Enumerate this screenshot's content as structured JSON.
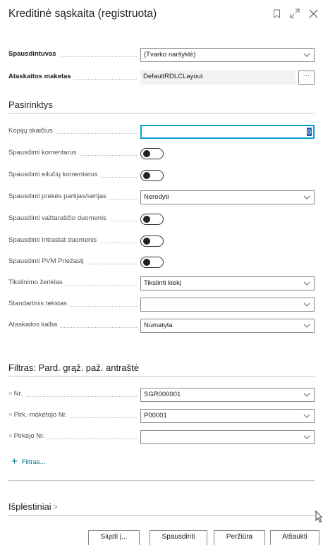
{
  "dialog": {
    "title": "Kreditinė sąskaita (registruota)",
    "icons": [
      "bookmark-icon",
      "expand-icon",
      "close-icon"
    ]
  },
  "printer": {
    "label": "Spausdintuvas",
    "value": "(Tvarko naršyklė)"
  },
  "layout": {
    "label": "Ataskaitos maketas",
    "value": "DefaultRDLCLayout",
    "more_label": "···"
  },
  "options": {
    "title": "Pasirinktys",
    "copies": {
      "label": "Kopijų skaičius",
      "value": "0"
    },
    "print_comments": {
      "label": "Spausdinti komentarus",
      "on": false
    },
    "print_line_comments": {
      "label": "Spausdinti eilučių komentarus",
      "on": false
    },
    "print_lots": {
      "label": "Spausdinti prekės partijas/serijas",
      "value": "Nerodyti"
    },
    "print_shipment": {
      "label": "Spausdinti važtaraščio duomenis",
      "on": false
    },
    "print_intrastat": {
      "label": "Spausdinti Intrastat duomenis",
      "on": false
    },
    "print_vat_reason": {
      "label": "Spausdinti PVM Priežastį",
      "on": false
    },
    "adjust_mark": {
      "label": "Tikslinimo ženklas",
      "value": "Tikslinti kiekį"
    },
    "standard_text": {
      "label": "Standartinis tekstas",
      "value": ""
    },
    "report_language": {
      "label": "Ataskaitos kalba",
      "value": "Numatyta"
    }
  },
  "filters": {
    "title": "Filtras: Pard. grąž. paž. antraštė",
    "items": [
      {
        "label": "Nr.",
        "value": "SGR000001"
      },
      {
        "label": "Pirk.-mokėtojo Nr.",
        "value": "P00001"
      },
      {
        "label": "Pirkėjo Nr.",
        "value": ""
      }
    ],
    "add_label": "Filtras..."
  },
  "advanced": {
    "title": "Išplėstiniai",
    "chevron": ">"
  },
  "footer": {
    "send_label": "Siųsti į...",
    "print_label": "Spausdinti",
    "preview_label": "Peržiūra",
    "cancel_label": "Atšaukti"
  },
  "colors": {
    "accent": "#00a2d6",
    "link": "#0e6b8e",
    "border": "#8a8886"
  }
}
